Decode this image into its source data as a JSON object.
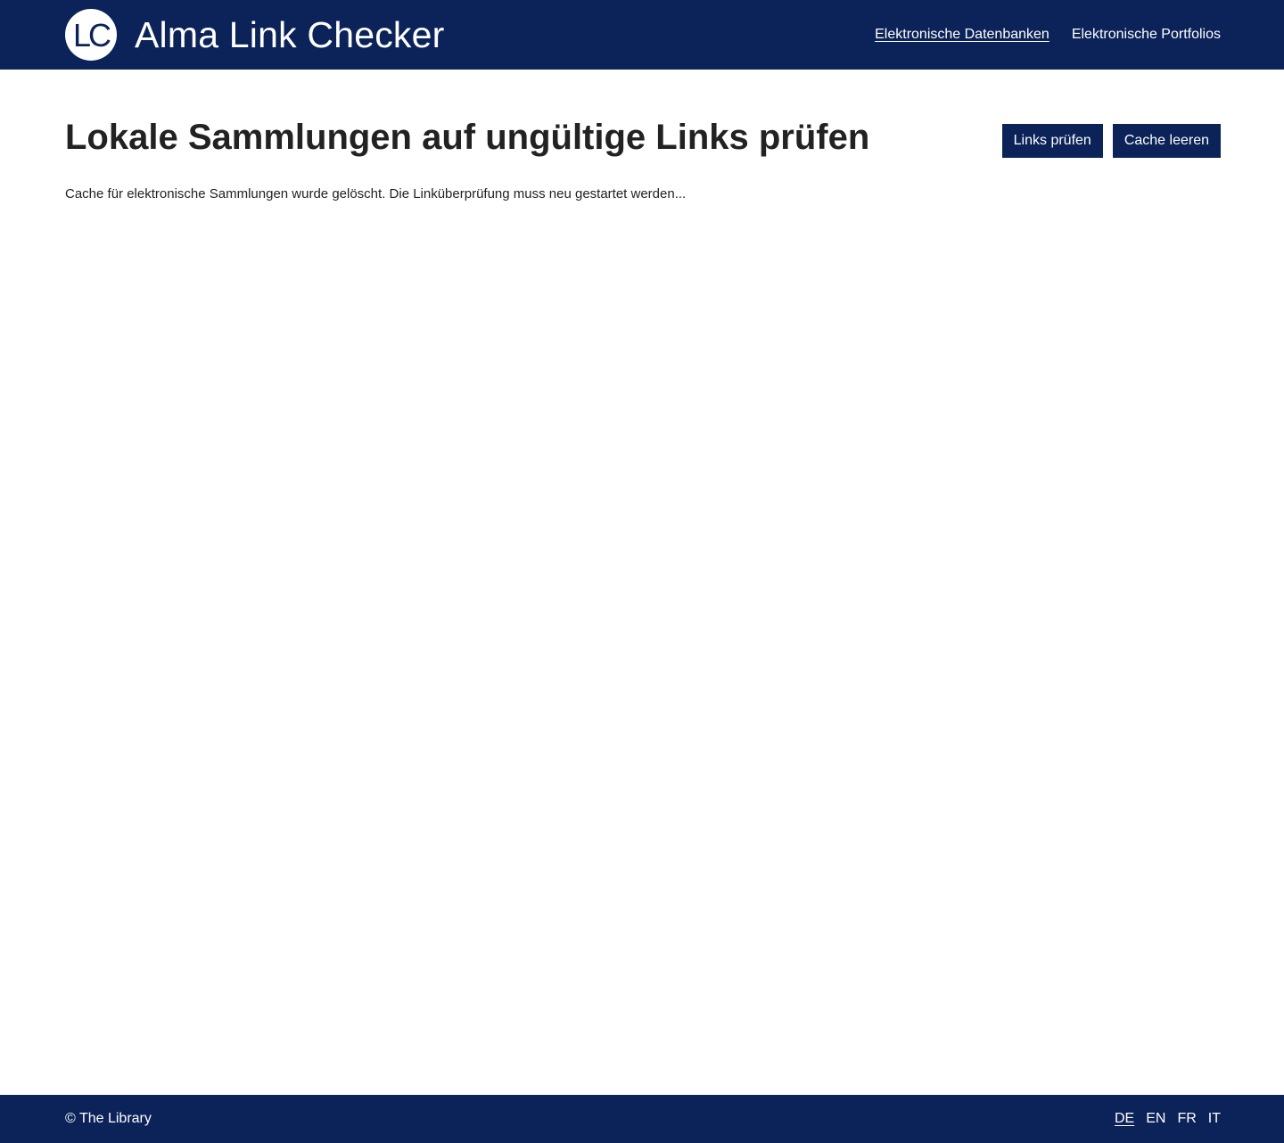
{
  "header": {
    "logo_text": "LC",
    "app_title": "Alma Link Checker",
    "nav": [
      {
        "label": "Elektronische Datenbanken",
        "active": true
      },
      {
        "label": "Elektronische Portfolios",
        "active": false
      }
    ]
  },
  "main": {
    "title": "Lokale Sammlungen auf ungültige Links prüfen",
    "buttons": {
      "check_links": "Links prüfen",
      "clear_cache": "Cache leeren"
    },
    "status_message": "Cache für elektronische Sammlungen wurde gelöscht. Die Linküberprüfung muss neu gestartet werden..."
  },
  "footer": {
    "copyright": "© The Library",
    "languages": [
      {
        "code": "DE",
        "active": true
      },
      {
        "code": "EN",
        "active": false
      },
      {
        "code": "FR",
        "active": false
      },
      {
        "code": "IT",
        "active": false
      }
    ]
  },
  "colors": {
    "brand": "#0b2358",
    "text": "#222222",
    "background": "#ffffff"
  }
}
